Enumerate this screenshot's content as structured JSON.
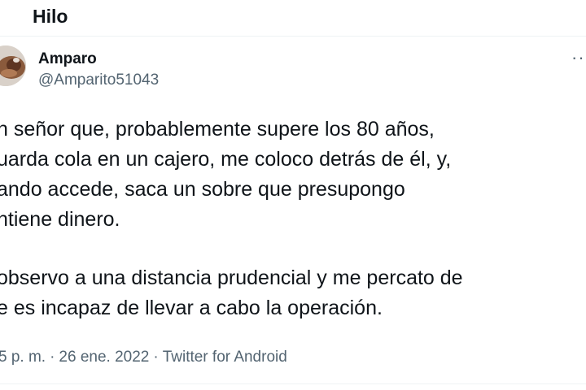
{
  "header": {
    "title": "Hilo"
  },
  "tweet": {
    "author": {
      "name": "Amparo",
      "handle": "@Amparito51043",
      "avatar": "avatar-photo"
    },
    "more_icon": "more-horizontal-icon",
    "more_label": "···",
    "paragraphs": [
      {
        "lines": [
          "n señor que, probablemente supere los 80 años,",
          "uarda cola en un cajero, me coloco detrás de él, y,",
          "ando accede, saca un sobre que presupongo",
          "ntiene dinero."
        ]
      },
      {
        "lines": [
          " observo a una distancia prudencial y me percato de",
          "e es incapaz de llevar a cabo la operación."
        ]
      }
    ],
    "meta": {
      "time": "5 p. m.",
      "separator": "·",
      "date": "26 ene. 2022",
      "source": "Twitter for Android"
    }
  },
  "colors": {
    "text_primary": "#0f1419",
    "text_secondary": "#536471",
    "divider": "#eff3f4"
  }
}
